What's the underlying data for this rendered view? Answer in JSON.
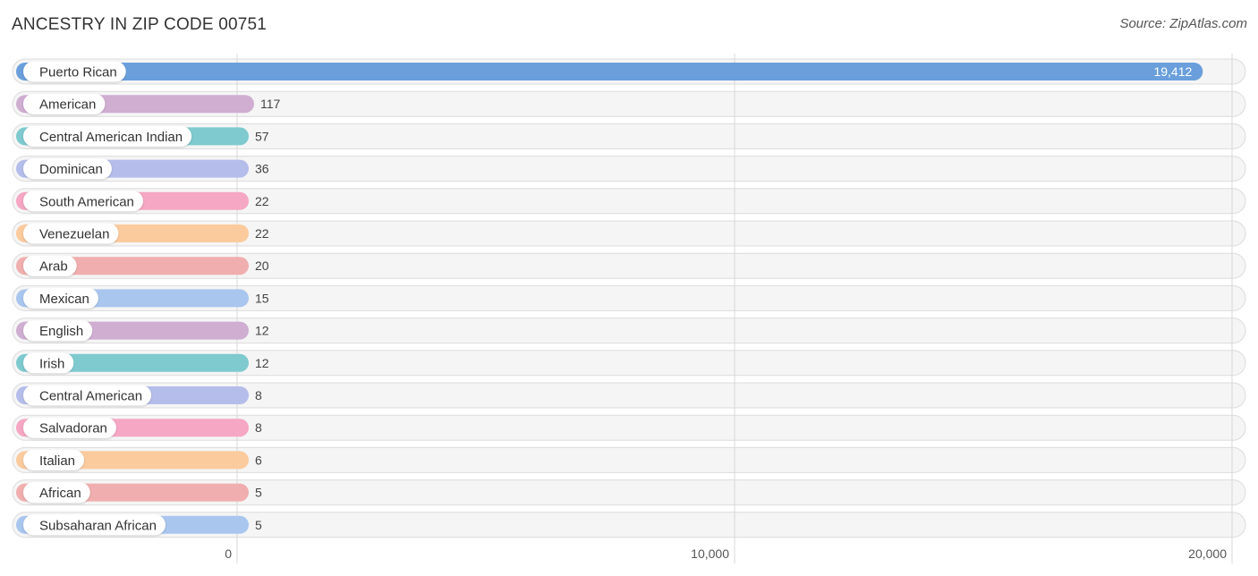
{
  "header": {
    "title": "ANCESTRY IN ZIP CODE 00751",
    "source": "Source: ZipAtlas.com"
  },
  "chart_data": {
    "type": "bar",
    "orientation": "horizontal",
    "title": "ANCESTRY IN ZIP CODE 00751",
    "xlabel": "",
    "ylabel": "",
    "xlim": [
      0,
      20000
    ],
    "x_ticks": [
      0,
      10000,
      20000
    ],
    "x_tick_labels": [
      "0",
      "10,000",
      "20,000"
    ],
    "grid": true,
    "categories": [
      "Puerto Rican",
      "American",
      "Central American Indian",
      "Dominican",
      "South American",
      "Venezuelan",
      "Arab",
      "Mexican",
      "English",
      "Irish",
      "Central American",
      "Salvadoran",
      "Italian",
      "African",
      "Subsaharan African"
    ],
    "values": [
      19412,
      117,
      57,
      36,
      22,
      22,
      20,
      15,
      12,
      12,
      8,
      8,
      6,
      5,
      5
    ],
    "value_labels": [
      "19,412",
      "117",
      "57",
      "36",
      "22",
      "22",
      "20",
      "15",
      "12",
      "12",
      "8",
      "8",
      "6",
      "5",
      "5"
    ],
    "colors": [
      "#6a9fdc",
      "#cfaed2",
      "#7ecacf",
      "#b5bdea",
      "#f5a7c3",
      "#fbcb9e",
      "#f0aeae",
      "#a9c6ee",
      "#cfaed2",
      "#7ecacf",
      "#b5bdea",
      "#f5a7c3",
      "#fbcb9e",
      "#f0aeae",
      "#a9c6ee"
    ]
  }
}
